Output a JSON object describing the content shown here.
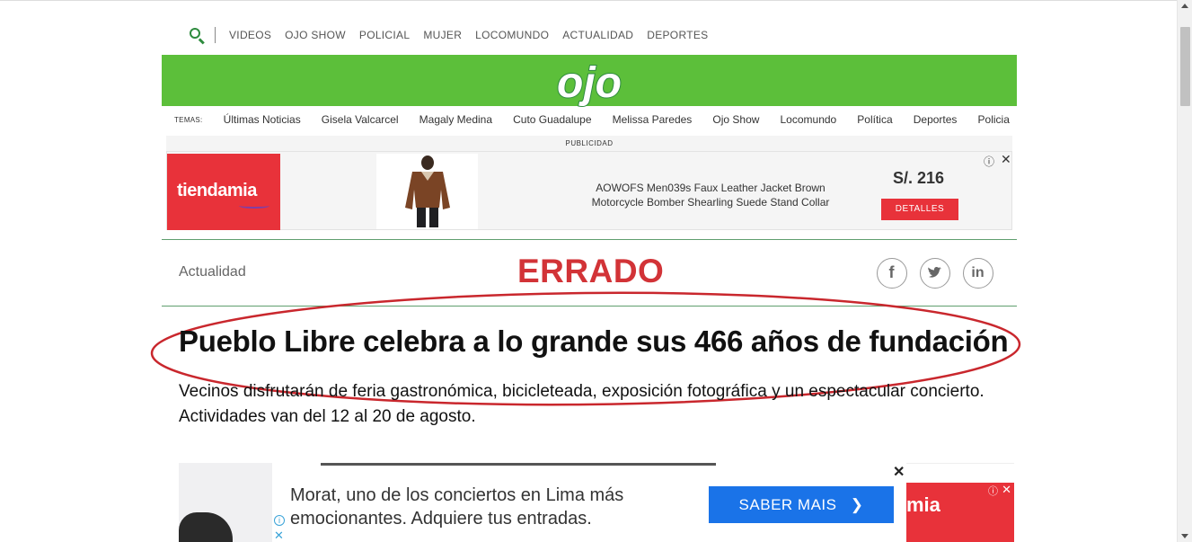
{
  "top_nav": {
    "items": [
      "VIDEOS",
      "OJO SHOW",
      "POLICIAL",
      "MUJER",
      "LOCOMUNDO",
      "ACTUALIDAD",
      "DEPORTES"
    ]
  },
  "logo": {
    "text": "ojo"
  },
  "colors": {
    "brand_green": "#5cbf3a",
    "accent_red": "#d23337",
    "ad_red": "#e8323a",
    "cta_blue": "#1a73e8"
  },
  "temas": {
    "label": "TEMAS:",
    "items": [
      "Últimas Noticias",
      "Gisela Valcarcel",
      "Magaly Medina",
      "Cuto Guadalupe",
      "Melissa Paredes",
      "Ojo Show",
      "Locomundo",
      "Política",
      "Deportes",
      "Policia"
    ]
  },
  "ad": {
    "label": "PUBLICIDAD",
    "brand": "tiendamia",
    "description": "AOWOFS Men039s Faux Leather Jacket Brown Motorcycle Bomber Shearling Suede Stand Collar",
    "price": "S/. 216",
    "cta": "DETALLES"
  },
  "article": {
    "section": "Actualidad",
    "stamp": "ERRADO",
    "headline": "Pueblo Libre celebra a lo grande sus 466 años de fundación",
    "subtitle": "Vecinos disfrutarán de feria gastronómica, bicicleteada, exposición fotográfica y un espectacular concierto. Actividades van del 12 al 20 de agosto."
  },
  "social": {
    "facebook": "f",
    "twitter": "t",
    "linkedin": "in"
  },
  "bottom_ad": {
    "text_line1": "Morat, uno de los conciertos en Lima más",
    "text_line2": "emocionantes. Adquiere tus entradas.",
    "cta": "SABER MAIS",
    "right_brand": "mia"
  }
}
